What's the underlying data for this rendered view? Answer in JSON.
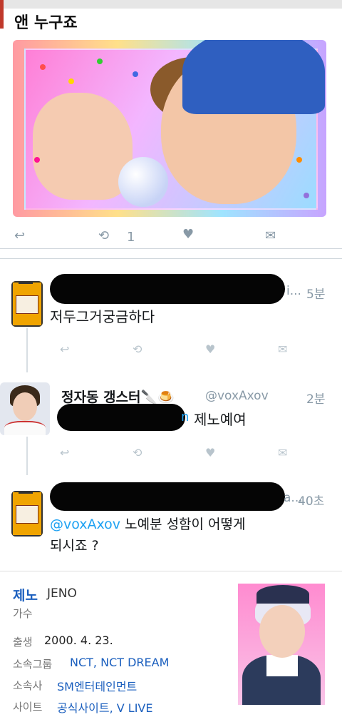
{
  "post": {
    "title": "앤 누구죠",
    "retweet_count": "1"
  },
  "replies": [
    {
      "time": "5분",
      "name_visible": "i...",
      "text": "저두그거궁금하다"
    },
    {
      "name": "정자동 갱스터🔪🍮",
      "handle": "@voxAxov",
      "time": "2분",
      "text_tail": "제노예여",
      "text_prefix": "@",
      "mention_tail": "n"
    },
    {
      "name_visible": "a...",
      "time": "40초",
      "mention": "@voxAxov",
      "text_line1": " 노예분 성함이 어떻게",
      "text_line2": "되시죠 ?"
    }
  ],
  "profile": {
    "name_ko": "제노",
    "name_en": "JENO",
    "job": "가수",
    "birth_label": "출생",
    "birth_value": "2000. 4. 23.",
    "group_label": "소속그룹",
    "group_value": "NCT, NCT DREAM",
    "agency_label": "소속사",
    "agency_value": "SM엔터테인먼트",
    "site_label": "사이트",
    "site_value": "공식사이트, V LIVE"
  },
  "icons": [
    "reply-icon",
    "retweet-icon",
    "like-icon",
    "dm-icon"
  ],
  "colors": {
    "link": "#1b5fbe",
    "mention": "#1da1f2",
    "icon_gray": "#8899a6"
  }
}
